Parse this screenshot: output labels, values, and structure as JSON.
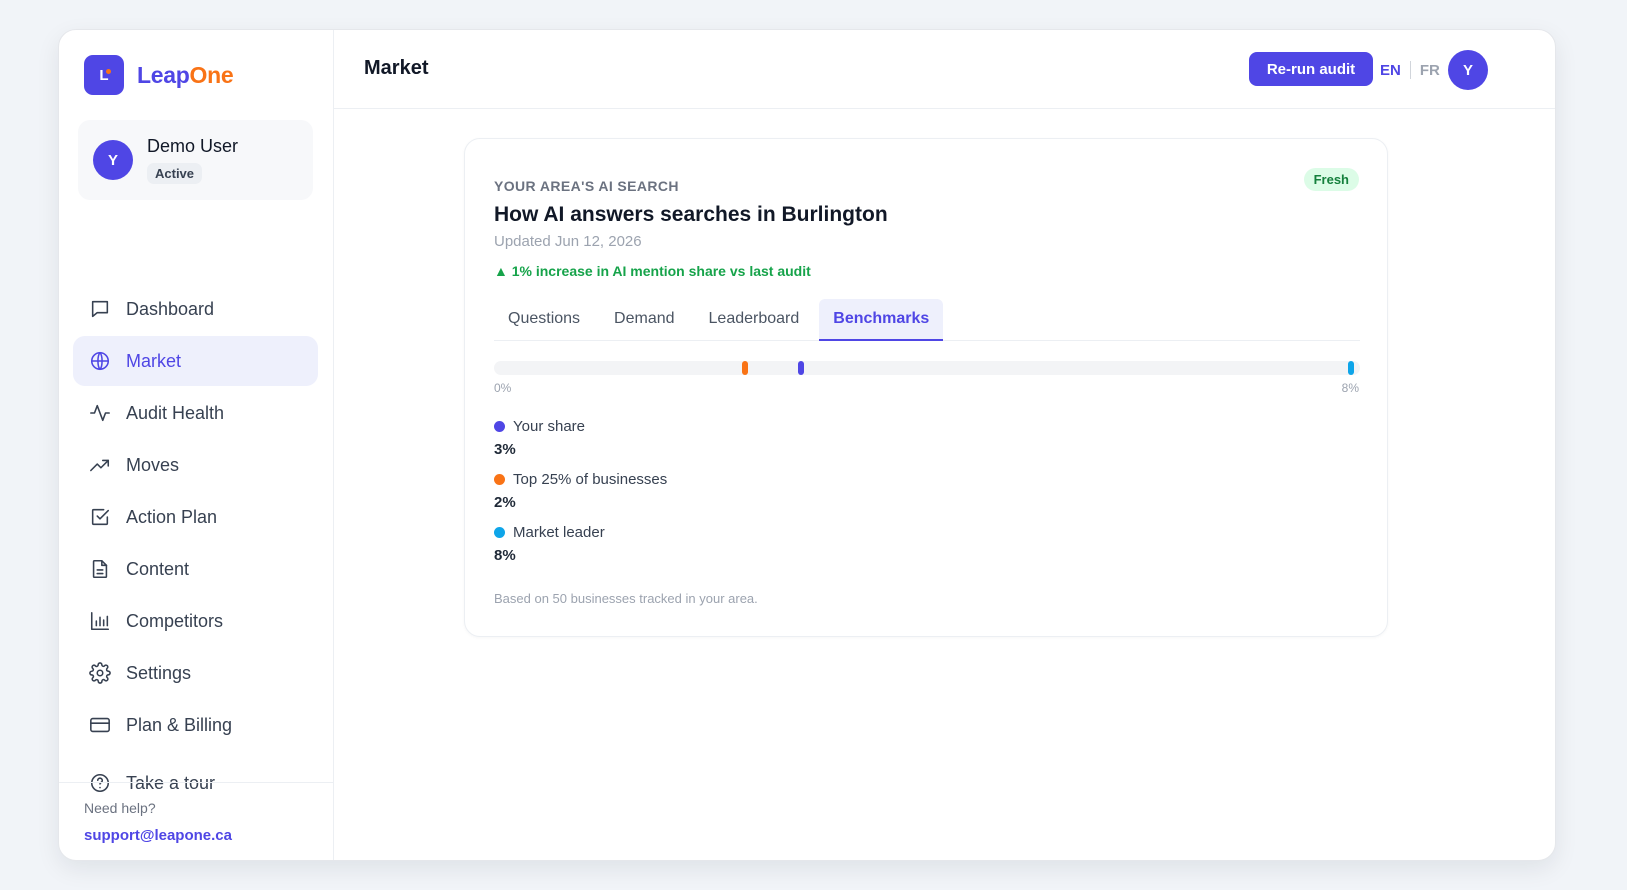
{
  "brand": {
    "logo_letter": "L",
    "name_part1": "Leap",
    "name_part2": "One"
  },
  "user": {
    "initial": "Y",
    "name": "Demo User",
    "status": "Active"
  },
  "nav": [
    {
      "label": "Dashboard",
      "icon": "chat-icon"
    },
    {
      "label": "Market",
      "icon": "globe-icon"
    },
    {
      "label": "Audit Health",
      "icon": "pulse-icon"
    },
    {
      "label": "Moves",
      "icon": "trending-up-icon"
    },
    {
      "label": "Action Plan",
      "icon": "checkbox-icon"
    },
    {
      "label": "Content",
      "icon": "document-icon"
    },
    {
      "label": "Competitors",
      "icon": "bar-chart-icon"
    },
    {
      "label": "Settings",
      "icon": "gear-icon"
    },
    {
      "label": "Plan & Billing",
      "icon": "credit-card-icon"
    }
  ],
  "tour": {
    "label": "Take a tour",
    "icon": "help-circle-icon"
  },
  "help": {
    "label": "Need help?",
    "email": "support@leapone.ca"
  },
  "header": {
    "title": "Market",
    "rerun_label": "Re-run audit",
    "lang_en": "EN",
    "lang_fr": "FR",
    "avatar_initial": "Y"
  },
  "card": {
    "eyebrow": "YOUR AREA'S AI SEARCH",
    "badge": "Fresh",
    "title": "How AI answers searches in Burlington",
    "updated": "Updated Jun 12, 2026",
    "trend": "▲ 1% increase in AI mention share vs last audit",
    "tabs": [
      "Questions",
      "Demand",
      "Leaderboard",
      "Benchmarks"
    ],
    "active_tab": "Benchmarks",
    "benchmark": {
      "axis_min_label": "0%",
      "axis_max_label": "8%",
      "max": 8,
      "items": [
        {
          "label": "Your share",
          "value": 3,
          "value_label": "3%",
          "color": "#4f46e5",
          "marker_pct": 0.355
        },
        {
          "label": "Top 25% of businesses",
          "value": 2,
          "value_label": "2%",
          "color": "#f97316",
          "marker_pct": 0.29
        },
        {
          "label": "Market leader",
          "value": 8,
          "value_label": "8%",
          "color": "#0ea5e9",
          "marker_pct": 0.99
        }
      ]
    },
    "footnote": "Based on 50 businesses tracked in your area."
  },
  "colors": {
    "accent": "#4f46e5",
    "brand_orange": "#f97316",
    "success": "#16a34a"
  }
}
